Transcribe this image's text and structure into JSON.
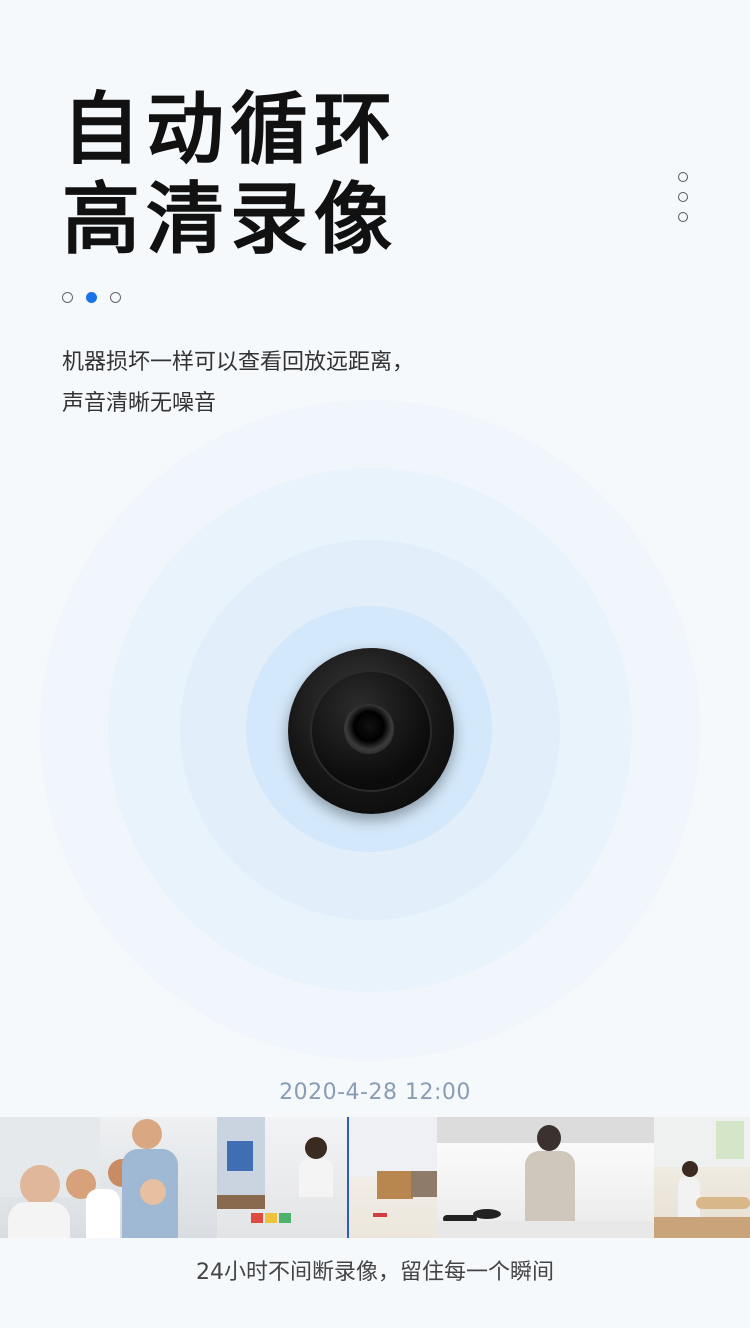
{
  "header": {
    "title_line1": "自动循环",
    "title_line2": "高清录像"
  },
  "description": {
    "line1": "机器损坏一样可以查看回放远距离，",
    "line2": "声音清晰无噪音"
  },
  "pager": {
    "total": 3,
    "active_index": 1
  },
  "colors": {
    "accent": "#1b74e4",
    "timestamp": "#8a9bb4"
  },
  "timestamp": "2020-4-28  12:00",
  "caption": "24小时不间断录像，留住每一个瞬间"
}
